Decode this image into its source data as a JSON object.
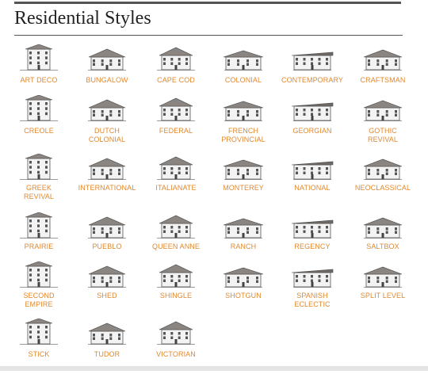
{
  "page": {
    "title": "Residential Styles",
    "link_color": "#e0892f"
  },
  "styles": [
    [
      "ART DECO"
    ],
    [
      "BUNGALOW"
    ],
    [
      "CAPE COD"
    ],
    [
      "COLONIAL"
    ],
    [
      "CONTEMPORARY"
    ],
    [
      "CRAFTSMAN"
    ],
    [
      "CREOLE"
    ],
    [
      "DUTCH",
      "COLONIAL"
    ],
    [
      "FEDERAL"
    ],
    [
      "FRENCH",
      "PROVINCIAL"
    ],
    [
      "GEORGIAN"
    ],
    [
      "GOTHIC",
      "REVIVAL"
    ],
    [
      "GREEK",
      "REVIVAL"
    ],
    [
      "INTERNATIONAL"
    ],
    [
      "ITALIANATE"
    ],
    [
      "MONTEREY"
    ],
    [
      "NATIONAL"
    ],
    [
      "NEOCLASSICAL"
    ],
    [
      "PRAIRIE"
    ],
    [
      "PUEBLO"
    ],
    [
      "QUEEN ANNE"
    ],
    [
      "RANCH"
    ],
    [
      "REGENCY"
    ],
    [
      "SALTBOX"
    ],
    [
      "SECOND",
      "EMPIRE"
    ],
    [
      "SHED"
    ],
    [
      "SHINGLE"
    ],
    [
      "SHOTGUN"
    ],
    [
      "SPANISH",
      "ECLECTIC"
    ],
    [
      "SPLIT LEVEL"
    ],
    [
      "STICK"
    ],
    [
      "TUDOR"
    ],
    [
      "VICTORIAN"
    ]
  ]
}
